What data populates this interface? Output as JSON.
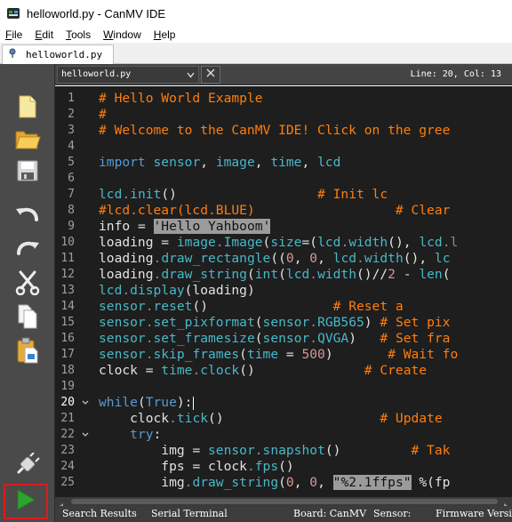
{
  "window": {
    "title": "helloworld.py - CanMV IDE"
  },
  "menu": [
    {
      "hotkey": "F",
      "rest": "ile"
    },
    {
      "hotkey": "E",
      "rest": "dit"
    },
    {
      "hotkey": "T",
      "rest": "ools"
    },
    {
      "hotkey": "W",
      "rest": "indow"
    },
    {
      "hotkey": "H",
      "rest": "elp"
    }
  ],
  "file_tab": {
    "label": "helloworld.py"
  },
  "editor_header": {
    "document": "helloworld.py",
    "cursor_position": "Line: 20, Col: 13"
  },
  "toolbar": {
    "icons": [
      "new-file-icon",
      "open-folder-icon",
      "save-icon",
      "undo-icon",
      "redo-icon",
      "cut-icon",
      "copy-icon",
      "paste-icon",
      "connect-icon",
      "run-icon"
    ]
  },
  "editor": {
    "current_line": 20,
    "fold_lines": [
      20,
      22
    ],
    "lines": [
      [
        [
          "# Hello World Example",
          "cmt"
        ]
      ],
      [
        [
          "#",
          "cmt"
        ]
      ],
      [
        [
          "# Welcome to the CanMV IDE! Click on the gree",
          "cmt"
        ]
      ],
      [],
      [
        [
          "import",
          "kw"
        ],
        [
          " ",
          ""
        ],
        [
          "sensor",
          "id"
        ],
        [
          ", ",
          ""
        ],
        [
          "image",
          "id"
        ],
        [
          ", ",
          ""
        ],
        [
          "time",
          "id"
        ],
        [
          ", ",
          ""
        ],
        [
          "lcd",
          "id"
        ]
      ],
      [],
      [
        [
          "lcd",
          "id"
        ],
        [
          ".",
          "dim"
        ],
        [
          "init",
          "id"
        ],
        [
          "()",
          ""
        ],
        [
          "                  ",
          ""
        ],
        [
          "# Init lc",
          "cmt"
        ]
      ],
      [
        [
          "#lcd.clear(lcd.BLUE)",
          "cmt"
        ],
        [
          "                  ",
          ""
        ],
        [
          "# Clear",
          "cmt"
        ]
      ],
      [
        [
          "info",
          ""
        ],
        [
          " = ",
          ""
        ],
        [
          "'Hello Yahboom'",
          "str"
        ]
      ],
      [
        [
          "loading",
          ""
        ],
        [
          " = ",
          ""
        ],
        [
          "image",
          "id"
        ],
        [
          ".",
          "dim"
        ],
        [
          "Image",
          "id"
        ],
        [
          "(",
          ""
        ],
        [
          "size",
          "id"
        ],
        [
          "=(",
          ""
        ],
        [
          "lcd",
          "id"
        ],
        [
          ".",
          "dim"
        ],
        [
          "width",
          "id"
        ],
        [
          "(), ",
          ""
        ],
        [
          "lcd",
          "id"
        ],
        [
          ".l",
          "dim"
        ]
      ],
      [
        [
          "loading",
          ""
        ],
        [
          ".",
          "dim"
        ],
        [
          "draw_rectangle",
          "id"
        ],
        [
          "((",
          ""
        ],
        [
          "0",
          "num"
        ],
        [
          ", ",
          ""
        ],
        [
          "0",
          "num"
        ],
        [
          ", ",
          ""
        ],
        [
          "lcd",
          "id"
        ],
        [
          ".",
          "dim"
        ],
        [
          "width",
          "id"
        ],
        [
          "(), ",
          ""
        ],
        [
          "lc",
          "id"
        ]
      ],
      [
        [
          "loading",
          ""
        ],
        [
          ".",
          "dim"
        ],
        [
          "draw_string",
          "id"
        ],
        [
          "(",
          ""
        ],
        [
          "int",
          "id"
        ],
        [
          "(",
          ""
        ],
        [
          "lcd",
          "id"
        ],
        [
          ".",
          "dim"
        ],
        [
          "width",
          "id"
        ],
        [
          "()//",
          ""
        ],
        [
          "2",
          "num"
        ],
        [
          " - ",
          ""
        ],
        [
          "len",
          "id"
        ],
        [
          "(",
          ""
        ]
      ],
      [
        [
          "lcd",
          "id"
        ],
        [
          ".",
          "dim"
        ],
        [
          "display",
          "id"
        ],
        [
          "(loading)",
          ""
        ]
      ],
      [
        [
          "sensor",
          "id"
        ],
        [
          ".",
          "dim"
        ],
        [
          "reset",
          "id"
        ],
        [
          "()",
          ""
        ],
        [
          "                ",
          ""
        ],
        [
          "# Reset a",
          "cmt"
        ]
      ],
      [
        [
          "sensor",
          "id"
        ],
        [
          ".",
          "dim"
        ],
        [
          "set_pixformat",
          "id"
        ],
        [
          "(",
          ""
        ],
        [
          "sensor",
          "id"
        ],
        [
          ".",
          "dim"
        ],
        [
          "RGB565",
          "id"
        ],
        [
          ")",
          ""
        ],
        [
          " ",
          ""
        ],
        [
          "# Set pix",
          "cmt"
        ]
      ],
      [
        [
          "sensor",
          "id"
        ],
        [
          ".",
          "dim"
        ],
        [
          "set_framesize",
          "id"
        ],
        [
          "(",
          ""
        ],
        [
          "sensor",
          "id"
        ],
        [
          ".",
          "dim"
        ],
        [
          "QVGA",
          "id"
        ],
        [
          ")",
          ""
        ],
        [
          "   ",
          ""
        ],
        [
          "# Set fra",
          "cmt"
        ]
      ],
      [
        [
          "sensor",
          "id"
        ],
        [
          ".",
          "dim"
        ],
        [
          "skip_frames",
          "id"
        ],
        [
          "(",
          ""
        ],
        [
          "time",
          "id"
        ],
        [
          " = ",
          ""
        ],
        [
          "500",
          "num"
        ],
        [
          ")",
          ""
        ],
        [
          "       ",
          ""
        ],
        [
          "# Wait fo",
          "cmt"
        ]
      ],
      [
        [
          "clock",
          ""
        ],
        [
          " = ",
          ""
        ],
        [
          "time",
          "id"
        ],
        [
          ".",
          "dim"
        ],
        [
          "clock",
          "id"
        ],
        [
          "()",
          ""
        ],
        [
          "              ",
          ""
        ],
        [
          "# Create",
          "cmt"
        ]
      ],
      [],
      [
        [
          "while",
          "kw"
        ],
        [
          "(",
          ""
        ],
        [
          "True",
          "kw"
        ],
        [
          "):",
          ""
        ]
      ],
      [
        [
          "    clock",
          ""
        ],
        [
          ".",
          "dim"
        ],
        [
          "tick",
          "id"
        ],
        [
          "()",
          ""
        ],
        [
          "                    ",
          ""
        ],
        [
          "# Update",
          "cmt"
        ]
      ],
      [
        [
          "    ",
          ""
        ],
        [
          "try",
          "kw"
        ],
        [
          ":",
          ""
        ]
      ],
      [
        [
          "        img",
          ""
        ],
        [
          " = ",
          ""
        ],
        [
          "sensor",
          "id"
        ],
        [
          ".",
          "dim"
        ],
        [
          "snapshot",
          "id"
        ],
        [
          "()",
          ""
        ],
        [
          "         ",
          ""
        ],
        [
          "# Tak",
          "cmt"
        ]
      ],
      [
        [
          "        fps",
          ""
        ],
        [
          " = ",
          ""
        ],
        [
          "clock",
          ""
        ],
        [
          ".",
          "dim"
        ],
        [
          "fps",
          "id"
        ],
        [
          "()",
          ""
        ]
      ],
      [
        [
          "        img",
          ""
        ],
        [
          ".",
          "dim"
        ],
        [
          "draw_string",
          "id"
        ],
        [
          "(",
          ""
        ],
        [
          "0",
          "num"
        ],
        [
          ", ",
          ""
        ],
        [
          "0",
          "num"
        ],
        [
          ", ",
          ""
        ],
        [
          "\"%2.1ffps\"",
          "str"
        ],
        [
          " %(fp",
          ""
        ]
      ]
    ]
  },
  "statusbar": {
    "search_results": "Search Results",
    "serial_terminal": "Serial Terminal",
    "board": "Board: CanMV",
    "sensor": "Sensor:",
    "firmware": "Firmware Versi"
  },
  "colors": {
    "comment": "#ff7e0d",
    "keyword": "#569ad4",
    "identifier": "#49b7c8",
    "number": "#d89797",
    "editor_bg": "#1e1e1e",
    "sidebar_bg": "#4a4a4a",
    "run_highlight": "#e0191b",
    "run_green": "#2ea42e"
  }
}
